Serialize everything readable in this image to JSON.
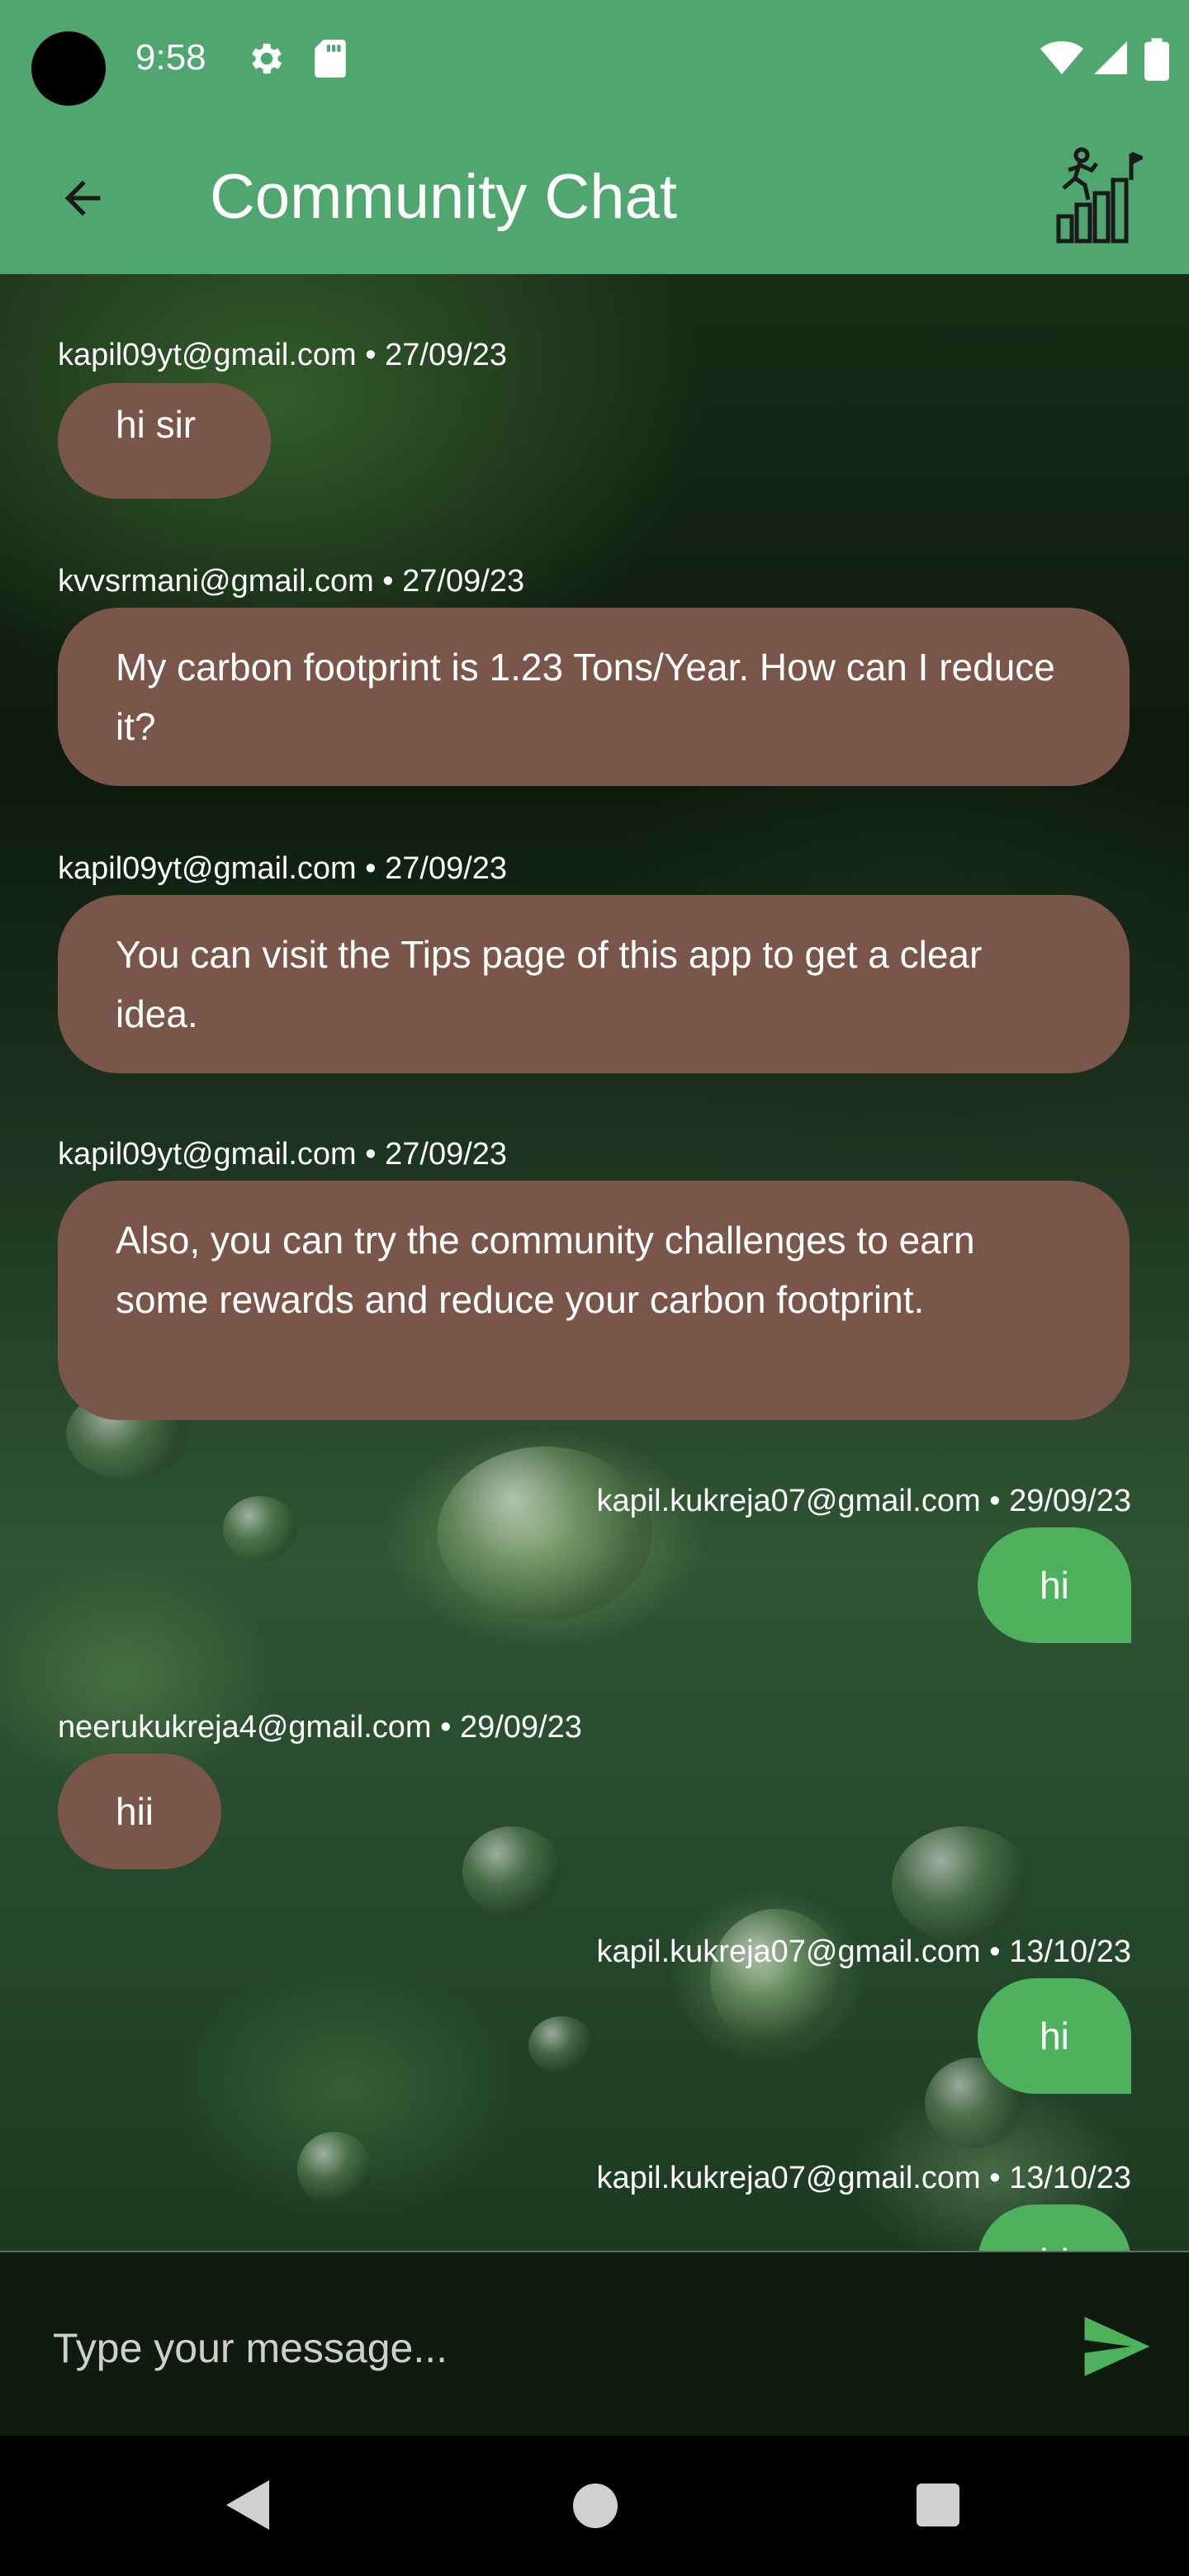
{
  "status_bar": {
    "time": "9:58",
    "icons": [
      "gear-icon",
      "sdcard-icon",
      "wifi-icon",
      "signal-icon",
      "battery-icon"
    ]
  },
  "app_bar": {
    "title": "Community Chat",
    "back_icon": "arrow-left-icon",
    "action_icon": "climbing-stairs-icon"
  },
  "messages": [
    {
      "sender": "kapil09yt@gmail.com • 27/09/23",
      "text": "hi sir",
      "mine": false
    },
    {
      "sender": "kvvsrmani@gmail.com • 27/09/23",
      "text": "My carbon footprint is 1.23 Tons/Year. How can I reduce it?",
      "mine": false
    },
    {
      "sender": "kapil09yt@gmail.com • 27/09/23",
      "text": "You can visit the Tips page of this app to get a clear idea.",
      "mine": false
    },
    {
      "sender": "kapil09yt@gmail.com • 27/09/23",
      "text": "Also, you can try the community challenges to earn some rewards and reduce your carbon footprint.",
      "mine": false
    },
    {
      "sender": "kapil.kukreja07@gmail.com • 29/09/23",
      "text": "hi",
      "mine": true
    },
    {
      "sender": "neerukukreja4@gmail.com • 29/09/23",
      "text": "hii",
      "mine": false
    },
    {
      "sender": "kapil.kukreja07@gmail.com • 13/10/23",
      "text": "hi",
      "mine": true
    },
    {
      "sender": "kapil.kukreja07@gmail.com • 13/10/23",
      "text": "hi",
      "mine": true
    }
  ],
  "composer": {
    "placeholder": "Type your message...",
    "send_icon": "send-icon"
  },
  "colors": {
    "app_bar": "#4fa66e",
    "bubble_other": "#7a564a",
    "bubble_mine": "#4db15e",
    "send_icon": "#4db15e"
  },
  "nav_bar": {
    "icons": [
      "back-triangle-icon",
      "home-circle-icon",
      "recents-square-icon"
    ]
  }
}
